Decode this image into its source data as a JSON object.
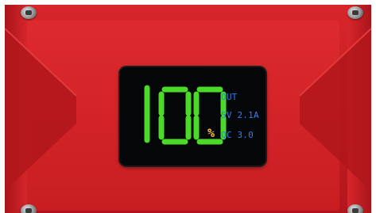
{
  "display": {
    "percentage": "100",
    "percent_symbol": "%",
    "out_label": "OUT",
    "output_voltage": "5V",
    "output_current": "2.1A",
    "qc_label": "QC 3.0"
  },
  "colors": {
    "body_red": "#c81e22",
    "screen_black": "#050607",
    "digit_green": "#4bd92a",
    "info_blue": "#2f7ff2",
    "percent_yellow": "#f7c03a"
  }
}
